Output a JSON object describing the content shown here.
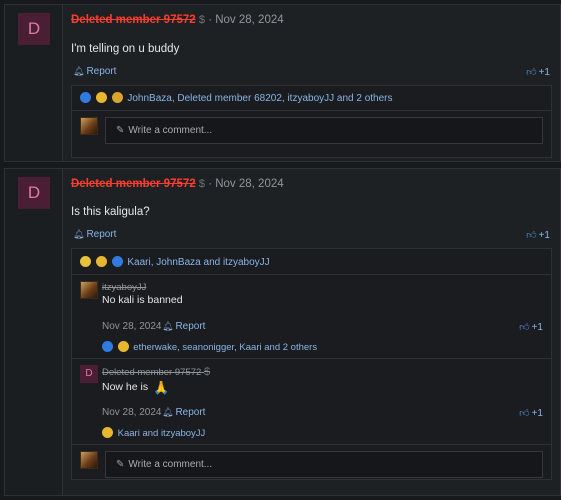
{
  "posts": [
    {
      "avatar_letter": "D",
      "author": "Deleted member 97572",
      "author_icon": "dollar-icon",
      "date_sep": "·",
      "date": "Nov 28, 2024",
      "body": "I'm telling on u buddy",
      "report_label": "Report",
      "like_label": "+1",
      "reactions_text": "JohnBaza, Deleted member 68202, itzyaboyJJ and 2 others",
      "comment_placeholder": "Write a comment..."
    },
    {
      "avatar_letter": "D",
      "author": "Deleted member 97572",
      "author_icon": "dollar-icon",
      "date_sep": "·",
      "date": "Nov 28, 2024",
      "body": "Is this kaligula?",
      "report_label": "Report",
      "like_label": "+1",
      "reactions_text": "Kaari, JohnBaza and itzyaboyJJ",
      "comment_placeholder": "Write a comment...",
      "replies": [
        {
          "author": "itzyaboyJJ",
          "body": "No kali is banned",
          "date": "Nov 28, 2024",
          "report_label": "Report",
          "like_label": "+1",
          "reactions_text": "etherwake, seanonigger, Kaari and 2 others"
        },
        {
          "avatar_letter": "D",
          "author": "Deleted member 97572",
          "body": "Now he is",
          "body_emoji": "🙏",
          "date": "Nov 28, 2024",
          "report_label": "Report",
          "like_label": "+1",
          "reactions_text": "Kaari and itzyaboyJJ"
        }
      ]
    }
  ],
  "colors": {
    "background": "#17191c",
    "panel": "#1e2124",
    "link": "#8ab4e6",
    "deleted_name": "#ff3d2e",
    "avatar_bg": "#4a1f33",
    "avatar_fg": "#e07aa8"
  }
}
